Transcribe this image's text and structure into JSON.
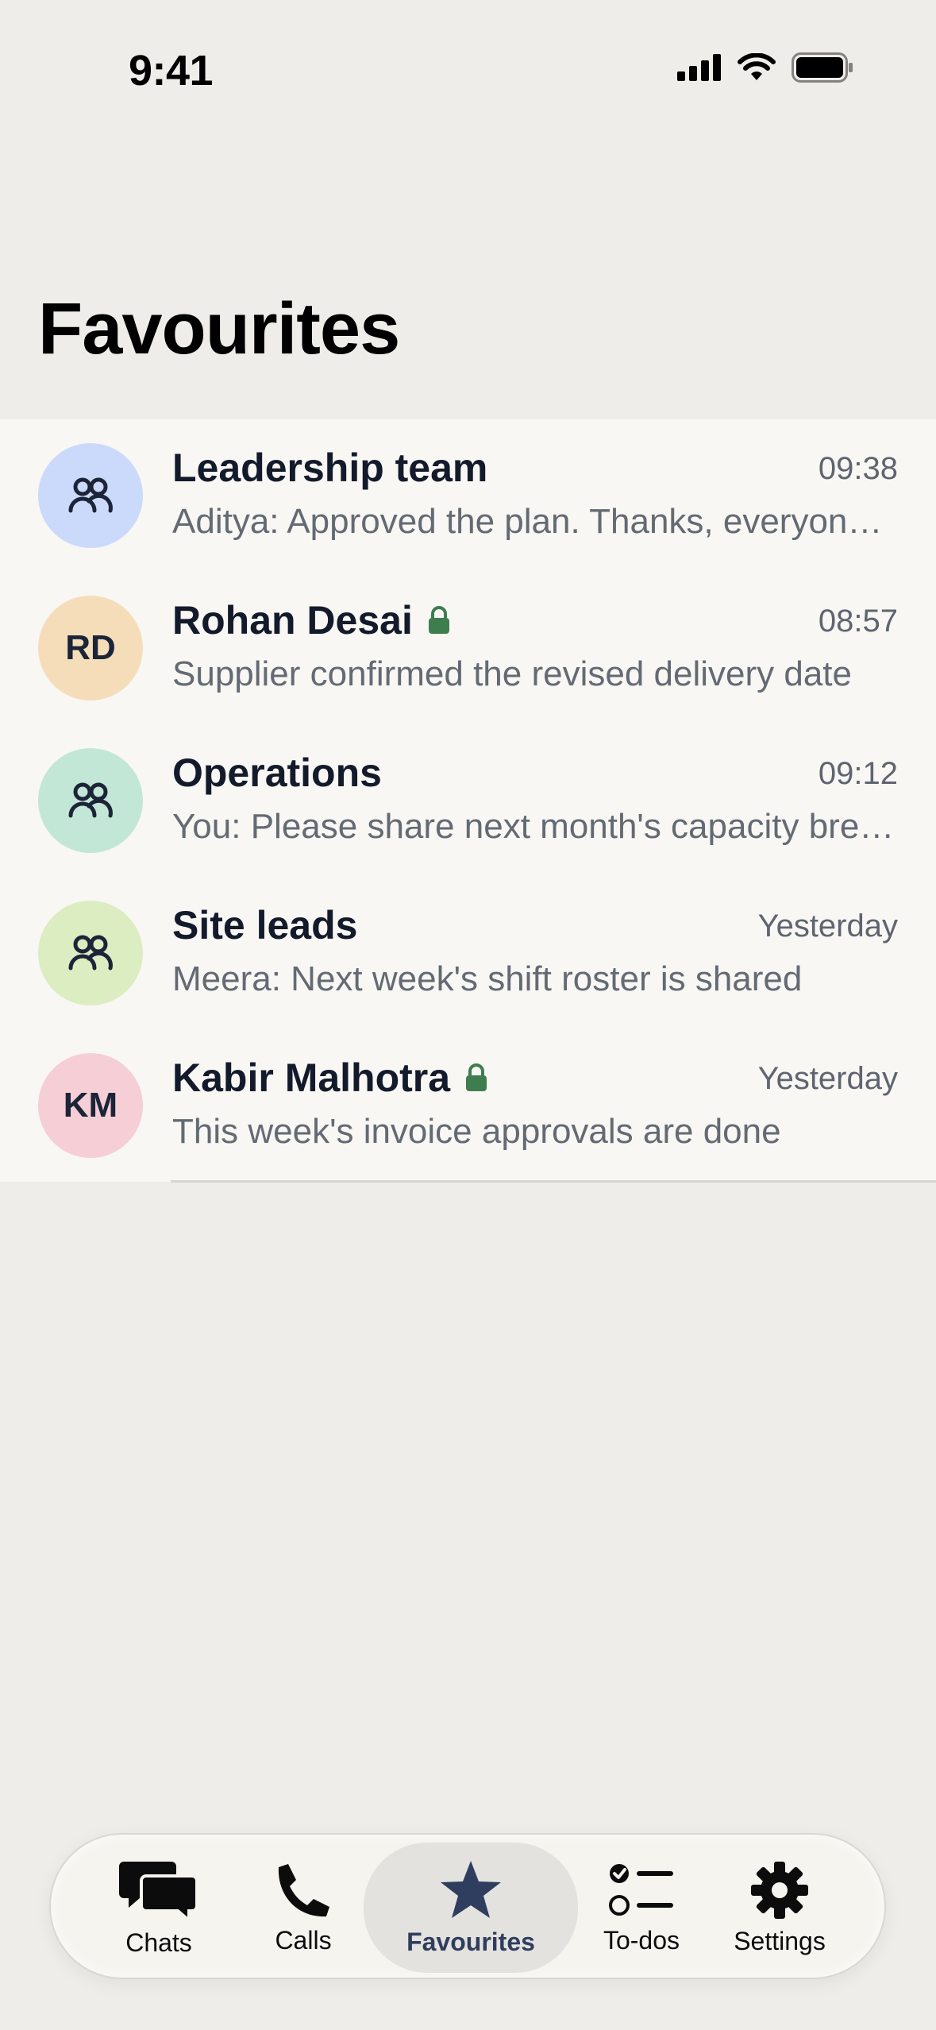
{
  "status": {
    "time": "9:41"
  },
  "page": {
    "title": "Favourites"
  },
  "chats": [
    {
      "name": "Leadership team",
      "time": "09:38",
      "preview": "Aditya: Approved the plan. Thanks, everyone for the quick review",
      "type": "group",
      "avatar_color": "#CBDAFA",
      "locked": false
    },
    {
      "name": "Rohan Desai",
      "time": "08:57",
      "preview": "Supplier confirmed the revised delivery date",
      "type": "person",
      "initials": "RD",
      "avatar_color": "#F6DDBA",
      "locked": true
    },
    {
      "name": "Operations",
      "time": "09:12",
      "preview": "You: Please share next month's capacity breakdown",
      "type": "group",
      "avatar_color": "#C3E7D6",
      "locked": false
    },
    {
      "name": "Site leads",
      "time": "Yesterday",
      "preview": "Meera: Next week's shift roster is shared",
      "type": "group",
      "avatar_color": "#DCEDC1",
      "locked": false
    },
    {
      "name": "Kabir Malhotra",
      "time": "Yesterday",
      "preview": "This week's invoice approvals are done",
      "type": "person",
      "initials": "KM",
      "avatar_color": "#F6CED6",
      "locked": true
    }
  ],
  "tabs": {
    "chats": "Chats",
    "calls": "Calls",
    "favourites": "Favourites",
    "todos": "To-dos",
    "settings": "Settings"
  },
  "colors": {
    "lock": "#3E7E4E",
    "active_tab": "#2F3D5E"
  }
}
